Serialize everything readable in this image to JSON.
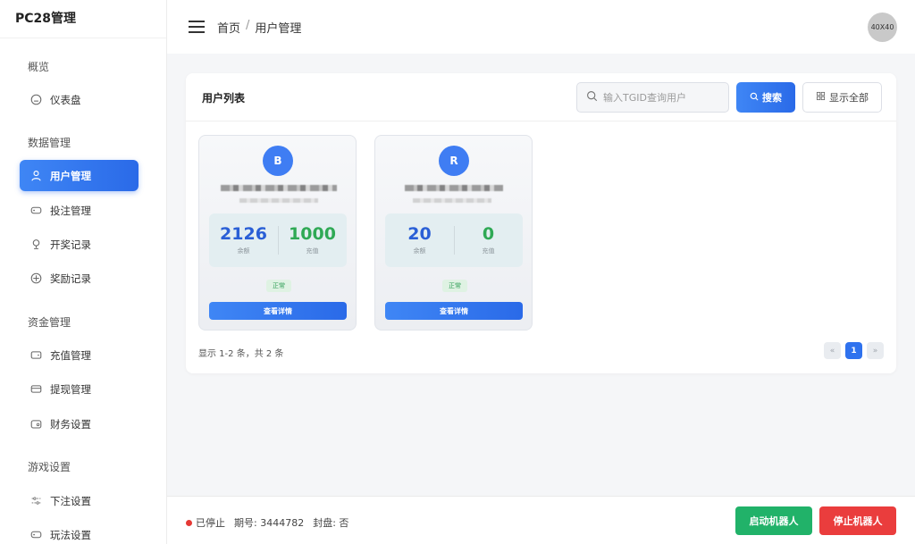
{
  "brand": "PC28管理",
  "sidebar": {
    "groups": [
      {
        "title": "概览"
      },
      {
        "title": "数据管理"
      },
      {
        "title": "资金管理"
      },
      {
        "title": "游戏设置"
      }
    ],
    "items": [
      {
        "label": "仪表盘",
        "icon": "dashboard-icon"
      },
      {
        "label": "用户管理",
        "icon": "user-icon",
        "active": true
      },
      {
        "label": "投注管理",
        "icon": "gamepad-icon"
      },
      {
        "label": "开奖记录",
        "icon": "trophy-icon"
      },
      {
        "label": "奖励记录",
        "icon": "gift-icon"
      },
      {
        "label": "充值管理",
        "icon": "wallet-icon"
      },
      {
        "label": "提现管理",
        "icon": "card-icon"
      },
      {
        "label": "财务设置",
        "icon": "finance-icon"
      },
      {
        "label": "下注设置",
        "icon": "sliders-icon"
      },
      {
        "label": "玩法设置",
        "icon": "gamepad-icon"
      }
    ]
  },
  "header": {
    "breadcrumb": [
      "首页",
      "用户管理"
    ],
    "breadcrumb_sep": "/",
    "avatar_text": "40X40"
  },
  "panel": {
    "title": "用户列表",
    "search_placeholder": "输入TGID查询用户",
    "search_button": "搜索",
    "show_all_button": "显示全部",
    "users": [
      {
        "initial": "B",
        "balance": "2126",
        "balance_label": "余额",
        "recharge": "1000",
        "recharge_label": "充值",
        "status": "正常",
        "detail_button": "查看详情"
      },
      {
        "initial": "R",
        "balance": "20",
        "balance_label": "余额",
        "recharge": "0",
        "recharge_label": "充值",
        "status": "正常",
        "detail_button": "查看详情"
      }
    ],
    "summary": "显示 1-2 条，共 2 条",
    "pager": {
      "prev": "«",
      "current": "1",
      "next": "»"
    }
  },
  "footer": {
    "status": "已停止",
    "period_label": "期号: 3444782",
    "closed_label": "封盘: 否",
    "start_button": "启动机器人",
    "stop_button": "停止机器人"
  },
  "colors": {
    "accent": "#2a6ae8",
    "balance": "#2a5fd6",
    "recharge": "#2fa955",
    "start": "#21b269",
    "stop": "#ea3d3d",
    "status_stopped": "#e53935"
  }
}
